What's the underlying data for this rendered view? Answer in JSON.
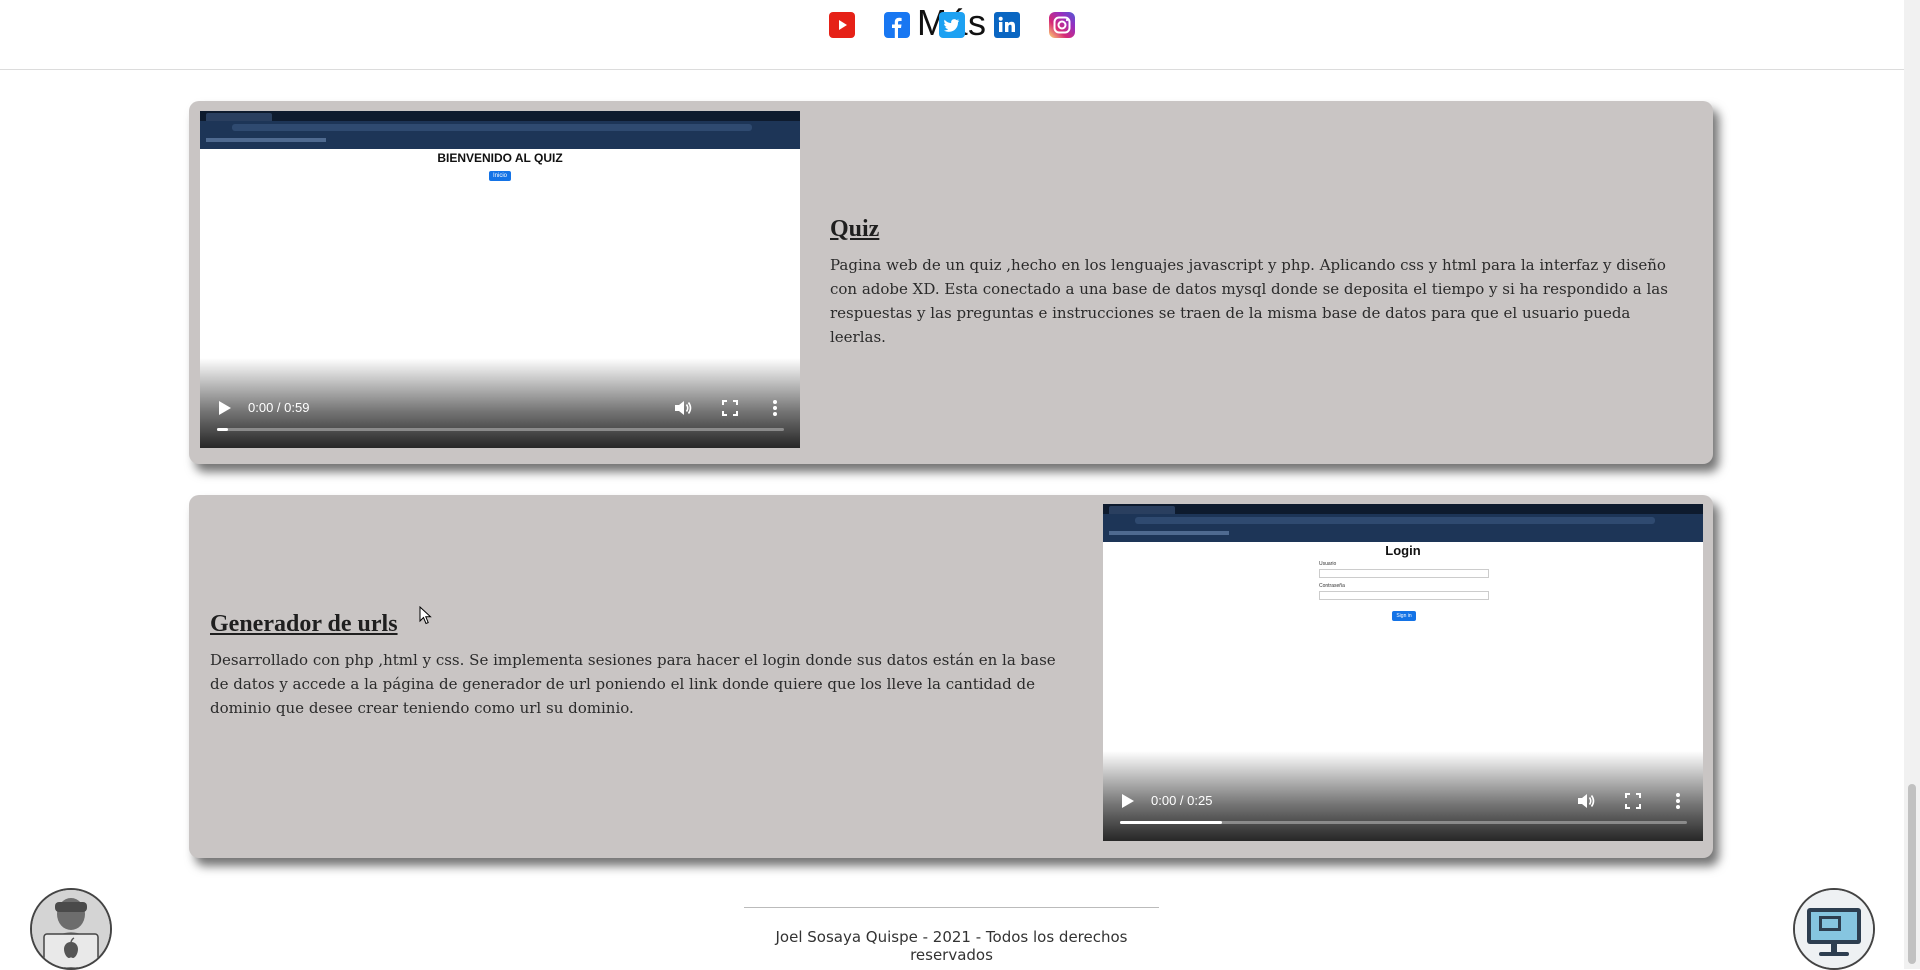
{
  "header": {
    "more_label": "Más",
    "social": [
      {
        "name": "youtube",
        "color": "#e62117"
      },
      {
        "name": "facebook",
        "color": "#1877f2"
      },
      {
        "name": "twitter",
        "color": "#1da1f2"
      },
      {
        "name": "linkedin",
        "color": "#0a66c2"
      },
      {
        "name": "instagram",
        "color": "#c13584"
      }
    ]
  },
  "projects": [
    {
      "title": "Quiz",
      "description": "Pagina web de un quiz ,hecho en los lenguajes javascript y php. Aplicando css y html para la interfaz y diseño con adobe XD. Esta conectado a una base de datos mysql donde se deposita el tiempo y si ha respondido a las respuestas y las preguntas e instrucciones se traen de la misma base de datos para que el usuario pueda leerlas.",
      "video": {
        "time": "0:00 / 0:59",
        "progress": 0.02,
        "preview_heading": "BIENVENIDO AL QUIZ",
        "preview_button": "Inicio"
      }
    },
    {
      "title": "Generador de urls",
      "description": "Desarrollado con php ,html y css. Se implementa sesiones para hacer el login donde sus datos están en la base de datos y accede a la página de generador de url poniendo el link donde quiere que los lleve la cantidad de dominio que desee crear teniendo como url su dominio.",
      "video": {
        "time": "0:00 / 0:25",
        "progress": 0.18,
        "preview_heading": "Login",
        "preview_user_label": "Usuario",
        "preview_pass_label": "Contraseña",
        "preview_button": "Sign in"
      }
    }
  ],
  "footer": {
    "text": "Joel Sosaya Quispe - 2021 - Todos los derechos reservados"
  }
}
